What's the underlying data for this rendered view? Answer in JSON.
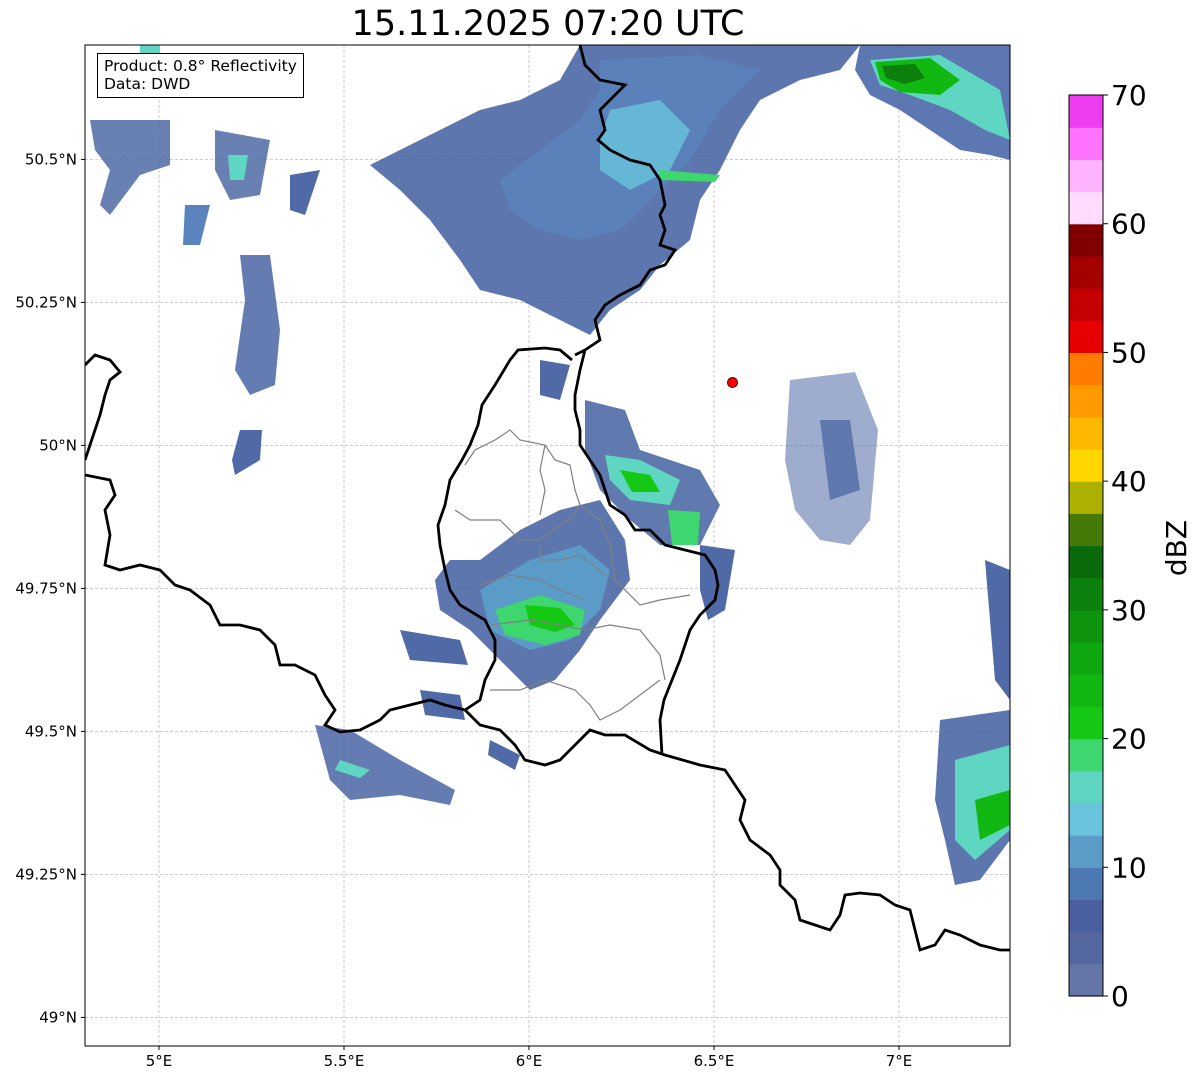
{
  "title": "15.11.2025 07:20 UTC",
  "info": {
    "product": "Product: 0.8° Reflectivity",
    "data": "Data: DWD"
  },
  "map": {
    "lon_range": [
      4.8,
      7.3
    ],
    "lat_range": [
      48.95,
      50.7
    ],
    "x_ticks": [
      {
        "value": 5.0,
        "label": "5°E"
      },
      {
        "value": 5.5,
        "label": "5.5°E"
      },
      {
        "value": 6.0,
        "label": "6°E"
      },
      {
        "value": 6.5,
        "label": "6.5°E"
      },
      {
        "value": 7.0,
        "label": "7°E"
      }
    ],
    "y_ticks": [
      {
        "value": 50.5,
        "label": "50.5°N"
      },
      {
        "value": 50.25,
        "label": "50.25°N"
      },
      {
        "value": 50.0,
        "label": "50°N"
      },
      {
        "value": 49.75,
        "label": "49.75°N"
      },
      {
        "value": 49.5,
        "label": "49.5°N"
      },
      {
        "value": 49.25,
        "label": "49.25°N"
      },
      {
        "value": 49.0,
        "label": "49°N"
      }
    ],
    "grid": true,
    "radar_site": {
      "lon": 6.55,
      "lat": 50.11,
      "color": "#ff0000"
    }
  },
  "colorbar": {
    "label": "dBZ",
    "range": [
      0,
      70
    ],
    "tick_values": [
      0,
      10,
      20,
      30,
      40,
      50,
      60,
      70
    ],
    "tick_labels": [
      "0",
      "10",
      "20",
      "30",
      "40",
      "50",
      "60",
      "70"
    ],
    "colors": [
      "#6475a8",
      "#55679f",
      "#4a5fa0",
      "#4d79b3",
      "#5b9bc8",
      "#69c3dc",
      "#5fd6c2",
      "#3ed66e",
      "#14c814",
      "#12b812",
      "#10a810",
      "#0e940e",
      "#0c800c",
      "#0a690a",
      "#467a08",
      "#acb000",
      "#ffd600",
      "#ffb800",
      "#ff9a00",
      "#ff7c00",
      "#e60000",
      "#c40000",
      "#a30000",
      "#800000",
      "#ffdcff",
      "#ffb4ff",
      "#ff73ff",
      "#ee3df0"
    ]
  }
}
